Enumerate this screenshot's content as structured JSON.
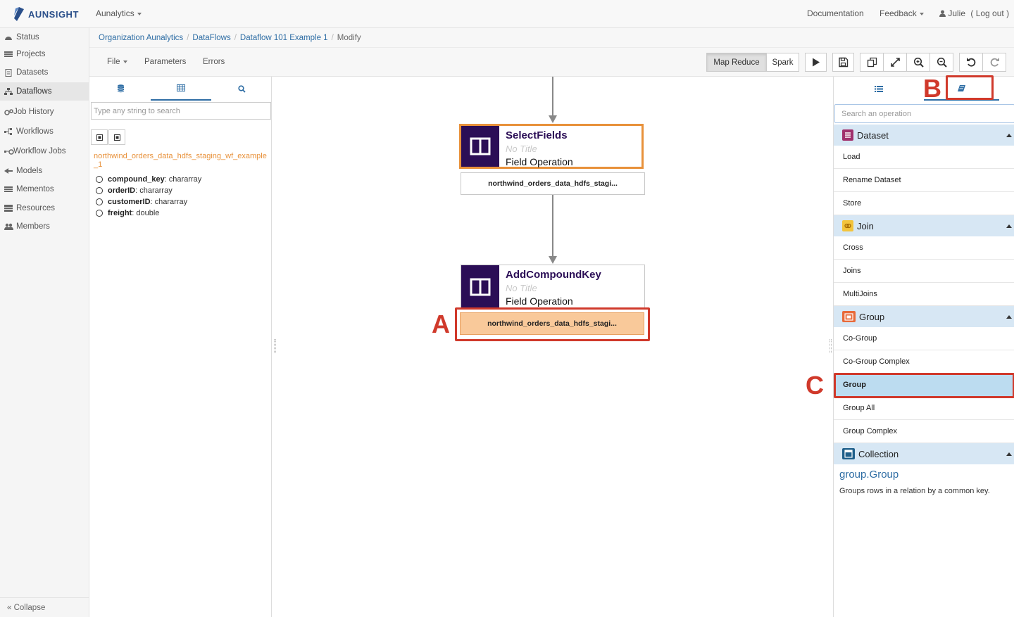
{
  "app": {
    "logo_text": "AUNSIGHT",
    "menu_label": "Aunalytics",
    "documentation_label": "Documentation",
    "feedback_label": "Feedback",
    "user_name": "Julie",
    "logout_label": "( Log out )",
    "brand_color": "#2a4f8a"
  },
  "sidebar": {
    "items": [
      {
        "label": "Status",
        "icon": "dashboard-icon"
      },
      {
        "label": "Projects",
        "icon": "list-icon"
      },
      {
        "label": "Datasets",
        "icon": "file-icon"
      },
      {
        "label": "Dataflows",
        "icon": "sitemap-icon"
      },
      {
        "label": "Job History",
        "icon": "cogs-icon"
      },
      {
        "label": "Workflows",
        "icon": "workflow-icon"
      },
      {
        "label": "Workflow Jobs",
        "icon": "workflow-jobs-icon"
      },
      {
        "label": "Models",
        "icon": "model-icon"
      },
      {
        "label": "Mementos",
        "icon": "list-icon"
      },
      {
        "label": "Resources",
        "icon": "server-icon"
      },
      {
        "label": "Members",
        "icon": "users-icon"
      }
    ],
    "active": "Dataflows",
    "collapse_label": "« Collapse"
  },
  "breadcrumb": {
    "items": [
      "Organization Aunalytics",
      "DataFlows",
      "Dataflow 101 Example 1"
    ],
    "current": "Modify"
  },
  "toolbar": {
    "file_label": "File",
    "parameters_label": "Parameters",
    "errors_label": "Errors",
    "map_reduce_label": "Map Reduce",
    "spark_label": "Spark",
    "active_engine": "Map Reduce"
  },
  "left_panel": {
    "search_placeholder": "Type any string to search",
    "dataset_name": "northwind_orders_data_hdfs_staging_wf_example_1",
    "fields": [
      {
        "name": "compound_key",
        "type": " : chararray"
      },
      {
        "name": "orderID",
        "type": " : chararray"
      },
      {
        "name": "customerID",
        "type": " : chararray"
      },
      {
        "name": "freight",
        "type": " : double"
      }
    ]
  },
  "canvas": {
    "nodes": [
      {
        "title": "SelectFields",
        "subtitle": "No Title",
        "type": "Field Operation",
        "output": "northwind_orders_data_hdfs_stagi...",
        "selected": true
      },
      {
        "title": "AddCompoundKey",
        "subtitle": "No Title",
        "type": "Field Operation",
        "output": "northwind_orders_data_hdfs_stagi...",
        "selected": false
      }
    ],
    "annotations": [
      "A",
      "B",
      "C"
    ],
    "node_color": "#2b0e56",
    "selected_color": "#e8913a",
    "annotation_color": "#d0392b"
  },
  "right_panel": {
    "search_placeholder": "Search an operation",
    "categories": [
      {
        "label": "Dataset",
        "items": [
          "Load",
          "Rename Dataset",
          "Store"
        ]
      },
      {
        "label": "Join",
        "items": [
          "Cross",
          "Joins",
          "MultiJoins"
        ]
      },
      {
        "label": "Group",
        "items": [
          "Co-Group",
          "Co-Group Complex",
          "Group",
          "Group All",
          "Group Complex"
        ]
      },
      {
        "label": "Collection",
        "items": []
      }
    ],
    "selected_operation": "Group",
    "doc_title": "group.Group",
    "doc_description": "Groups rows in a relation by a common key."
  }
}
